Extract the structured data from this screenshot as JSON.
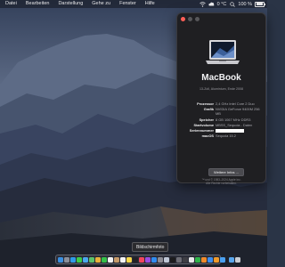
{
  "menubar": {
    "items": [
      "Datei",
      "Bearbeiten",
      "Darstellung",
      "Gehe zu",
      "Fenster",
      "Hilfe"
    ],
    "weather": "0 °C",
    "battery_percent": "100 %",
    "battery_level": 1.0
  },
  "about": {
    "title": "MacBook",
    "subtitle": "13-Zoll, Aluminium, Ende 2008",
    "specs": [
      {
        "label": "Prozessor",
        "value": "2,4 GHz Intel Core 2 Duo"
      },
      {
        "label": "Grafik",
        "value": "NVIDIA GeForce 9400M 256 MB"
      },
      {
        "label": "Speicher",
        "value": "8 GB 1067 MHz DDR3"
      },
      {
        "label": "Startvolume",
        "value": "MBSS_Sequoia - Daten"
      },
      {
        "label": "Seriennummer",
        "value": ""
      },
      {
        "label": "macOS",
        "value": "Sequoia 15.2"
      }
    ],
    "more_info_label": "Weitere Infos ...",
    "copyright_line1": "™ und © 1983–2024 Apple Inc.",
    "copyright_line2": "Alle Rechte vorbehalten."
  },
  "tooltip": "Bildschirmfoto",
  "dock": {
    "apps": [
      {
        "name": "finder-icon",
        "color": "#3a8fe0"
      },
      {
        "name": "launchpad-icon",
        "color": "#8a8f9a"
      },
      {
        "name": "safari-icon",
        "color": "#2f9be8"
      },
      {
        "name": "messages-icon",
        "color": "#3ccb4a"
      },
      {
        "name": "mail-icon",
        "color": "#4aa8ef"
      },
      {
        "name": "maps-icon",
        "color": "#5bc36a"
      },
      {
        "name": "photos-icon",
        "color": "#e9b23c"
      },
      {
        "name": "facetime-icon",
        "color": "#35c04a"
      },
      {
        "name": "calendar-icon",
        "color": "#f2f2f2"
      },
      {
        "name": "contacts-icon",
        "color": "#c59a6a"
      },
      {
        "name": "reminders-icon",
        "color": "#f4f4f4"
      },
      {
        "name": "notes-icon",
        "color": "#f7d84a"
      },
      {
        "name": "tv-icon",
        "color": "#222226"
      },
      {
        "name": "music-icon",
        "color": "#f2455c"
      },
      {
        "name": "podcasts-icon",
        "color": "#9a4ce0"
      },
      {
        "name": "appstore-icon",
        "color": "#2f8cf0"
      },
      {
        "name": "settings-icon",
        "color": "#8d8d95"
      },
      {
        "name": "preview-icon",
        "color": "#bfc7d6"
      },
      {
        "name": "terminal-icon",
        "color": "#1c1c1e"
      },
      {
        "name": "screenshot-icon",
        "color": "#6d6d75"
      },
      {
        "name": "activity-icon",
        "color": "#3e3e44"
      },
      {
        "name": "textedit-icon",
        "color": "#e8e8ea"
      },
      {
        "name": "numbers-icon",
        "color": "#2fb34a"
      },
      {
        "name": "pages-icon",
        "color": "#f08a2a"
      },
      {
        "name": "keynote-icon",
        "color": "#3c8ef0"
      },
      {
        "name": "home-icon",
        "color": "#f09a2a"
      },
      {
        "name": "weather-icon",
        "color": "#4aa0f0"
      }
    ],
    "trailing": [
      {
        "name": "downloads-icon",
        "color": "#5aa6ec"
      },
      {
        "name": "trash-icon",
        "color": "#c9ccd2"
      }
    ]
  }
}
